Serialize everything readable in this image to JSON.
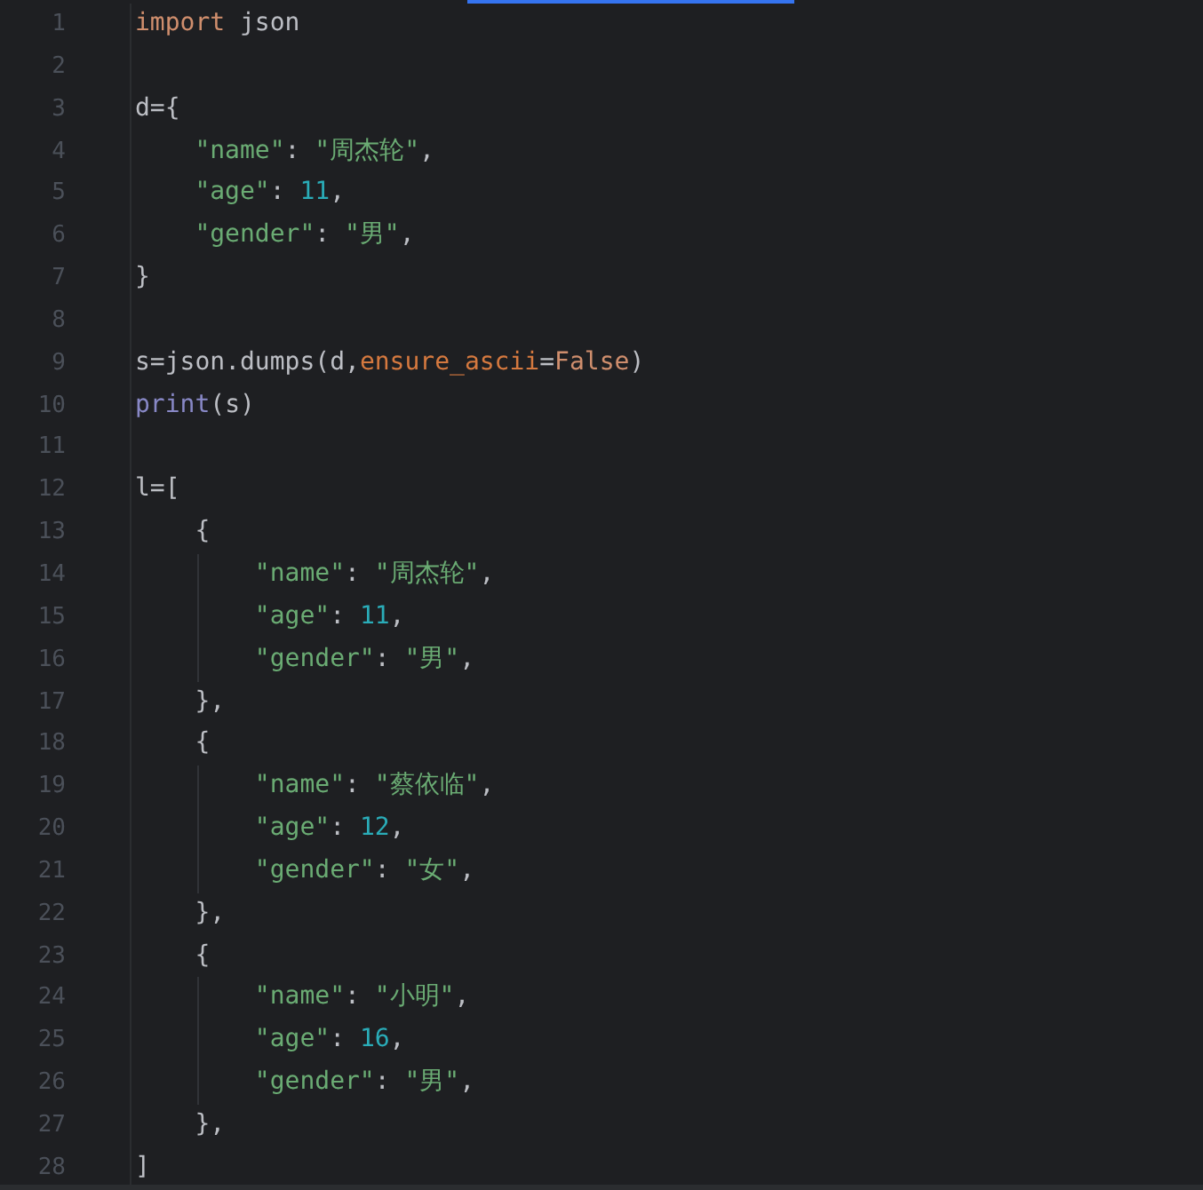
{
  "editor": {
    "lines": [
      {
        "number": "1",
        "kind": "top",
        "tokens": [
          {
            "text": "import",
            "kind": "keyword"
          },
          {
            "text": " json",
            "kind": "plain"
          }
        ]
      },
      {
        "number": "2",
        "kind": "top"
      },
      {
        "number": "3",
        "kind": "top",
        "tokens": [
          {
            "text": "d={",
            "kind": "plain"
          }
        ]
      },
      {
        "number": "4",
        "kind": "indented",
        "tokens": [
          {
            "text": "\"name\"",
            "kind": "string"
          },
          {
            "text": ": ",
            "kind": "plain"
          },
          {
            "text": "\"周杰轮\"",
            "kind": "string"
          },
          {
            "text": ",",
            "kind": "plain"
          }
        ]
      },
      {
        "number": "5",
        "kind": "indented",
        "tokens": [
          {
            "text": "\"age\"",
            "kind": "string"
          },
          {
            "text": ": ",
            "kind": "plain"
          },
          {
            "text": "11",
            "kind": "number"
          },
          {
            "text": ",",
            "kind": "plain"
          }
        ]
      },
      {
        "number": "6",
        "kind": "indented",
        "tokens": [
          {
            "text": "\"gender\"",
            "kind": "string"
          },
          {
            "text": ": ",
            "kind": "plain"
          },
          {
            "text": "\"男\"",
            "kind": "string"
          },
          {
            "text": ",",
            "kind": "plain"
          }
        ]
      },
      {
        "number": "7",
        "kind": "top",
        "tokens": [
          {
            "text": "}",
            "kind": "plain"
          }
        ]
      },
      {
        "number": "8",
        "kind": "top"
      },
      {
        "number": "9",
        "kind": "top",
        "tokens": [
          {
            "text": "s=json.dumps(d,",
            "kind": "plain"
          },
          {
            "text": "ensure_ascii",
            "kind": "param"
          },
          {
            "text": "=",
            "kind": "plain"
          },
          {
            "text": "False",
            "kind": "keyword"
          },
          {
            "text": ")",
            "kind": "plain"
          }
        ]
      },
      {
        "number": "10",
        "kind": "top",
        "tokens": [
          {
            "text": "print",
            "kind": "builtin"
          },
          {
            "text": "(s)",
            "kind": "plain"
          }
        ]
      },
      {
        "number": "11",
        "kind": "top"
      },
      {
        "number": "12",
        "kind": "top",
        "tokens": [
          {
            "text": "l=[",
            "kind": "plain"
          }
        ]
      },
      {
        "number": "13",
        "kind": "indented",
        "tokens": [
          {
            "text": "{",
            "kind": "plain"
          }
        ]
      },
      {
        "number": "14",
        "kind": "nested",
        "tokens": [
          {
            "text": "\"name\"",
            "kind": "string"
          },
          {
            "text": ": ",
            "kind": "plain"
          },
          {
            "text": "\"周杰轮\"",
            "kind": "string"
          },
          {
            "text": ",",
            "kind": "plain"
          }
        ]
      },
      {
        "number": "15",
        "kind": "nested",
        "tokens": [
          {
            "text": "\"age\"",
            "kind": "string"
          },
          {
            "text": ": ",
            "kind": "plain"
          },
          {
            "text": "11",
            "kind": "number"
          },
          {
            "text": ",",
            "kind": "plain"
          }
        ]
      },
      {
        "number": "16",
        "kind": "nested",
        "tokens": [
          {
            "text": "\"gender\"",
            "kind": "string"
          },
          {
            "text": ": ",
            "kind": "plain"
          },
          {
            "text": "\"男\"",
            "kind": "string"
          },
          {
            "text": ",",
            "kind": "plain"
          }
        ]
      },
      {
        "number": "17",
        "kind": "indented",
        "tokens": [
          {
            "text": "},",
            "kind": "plain"
          }
        ]
      },
      {
        "number": "18",
        "kind": "indented",
        "tokens": [
          {
            "text": "{",
            "kind": "plain"
          }
        ]
      },
      {
        "number": "19",
        "kind": "nested",
        "tokens": [
          {
            "text": "\"name\"",
            "kind": "string"
          },
          {
            "text": ": ",
            "kind": "plain"
          },
          {
            "text": "\"蔡依临\"",
            "kind": "string"
          },
          {
            "text": ",",
            "kind": "plain"
          }
        ]
      },
      {
        "number": "20",
        "kind": "nested",
        "tokens": [
          {
            "text": "\"age\"",
            "kind": "string"
          },
          {
            "text": ": ",
            "kind": "plain"
          },
          {
            "text": "12",
            "kind": "number"
          },
          {
            "text": ",",
            "kind": "plain"
          }
        ]
      },
      {
        "number": "21",
        "kind": "nested",
        "tokens": [
          {
            "text": "\"gender\"",
            "kind": "string"
          },
          {
            "text": ": ",
            "kind": "plain"
          },
          {
            "text": "\"女\"",
            "kind": "string"
          },
          {
            "text": ",",
            "kind": "plain"
          }
        ]
      },
      {
        "number": "22",
        "kind": "indented",
        "tokens": [
          {
            "text": "},",
            "kind": "plain"
          }
        ]
      },
      {
        "number": "23",
        "kind": "indented",
        "tokens": [
          {
            "text": "{",
            "kind": "plain"
          }
        ]
      },
      {
        "number": "24",
        "kind": "nested",
        "tokens": [
          {
            "text": "\"name\"",
            "kind": "string"
          },
          {
            "text": ": ",
            "kind": "plain"
          },
          {
            "text": "\"小明\"",
            "kind": "string"
          },
          {
            "text": ",",
            "kind": "plain"
          }
        ]
      },
      {
        "number": "25",
        "kind": "nested",
        "tokens": [
          {
            "text": "\"age\"",
            "kind": "string"
          },
          {
            "text": ": ",
            "kind": "plain"
          },
          {
            "text": "16",
            "kind": "number"
          },
          {
            "text": ",",
            "kind": "plain"
          }
        ]
      },
      {
        "number": "26",
        "kind": "nested",
        "tokens": [
          {
            "text": "\"gender\"",
            "kind": "string"
          },
          {
            "text": ": ",
            "kind": "plain"
          },
          {
            "text": "\"男\"",
            "kind": "string"
          },
          {
            "text": ",",
            "kind": "plain"
          }
        ]
      },
      {
        "number": "27",
        "kind": "indented",
        "tokens": [
          {
            "text": "},",
            "kind": "plain"
          }
        ]
      },
      {
        "number": "28",
        "kind": "top",
        "tokens": [
          {
            "text": "]",
            "kind": "plain"
          }
        ]
      }
    ]
  }
}
